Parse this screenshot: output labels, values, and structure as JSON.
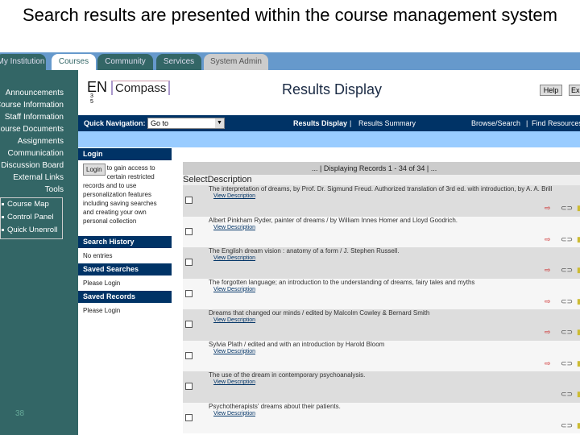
{
  "slide_title": "Search results are presented within the course management system",
  "tabs": [
    {
      "label": "My Institution"
    },
    {
      "label": "Courses"
    },
    {
      "label": "Community"
    },
    {
      "label": "Services"
    },
    {
      "label": "System Admin"
    }
  ],
  "sidebar": {
    "items": [
      "Announcements",
      "Course Information",
      "Staff Information",
      "Course Documents",
      "Assignments",
      "Communication",
      "Discussion Board",
      "External Links",
      "Tools"
    ],
    "tools": [
      "Course Map",
      "Control Panel",
      "Quick Unenroll"
    ]
  },
  "slide_number": "38",
  "logo": {
    "course": "EN",
    "number": "3 5",
    "name": "Compass"
  },
  "page_title": "Results Display",
  "help_label": "Help",
  "exit_label": "Exit",
  "quick_nav": {
    "label": "Quick Navigation:",
    "value": "Go to"
  },
  "nav": {
    "current": "Results Display",
    "summary": "Results Summary",
    "browse": "Browse/Search",
    "find": "Find Resources"
  },
  "panels": {
    "login_head": "Login",
    "login_button": "Login",
    "login_text": "to gain access to certain restricted records and to use personalization features including saving searches and creating your own personal collection",
    "history_head": "Search History",
    "history_text": "No entries",
    "saved_searches_head": "Saved Searches",
    "saved_searches_text": "Please Login",
    "saved_records_head": "Saved Records",
    "saved_records_text": "Please Login"
  },
  "results": {
    "status": "... | Displaying Records 1 - 34 of 34 | ...",
    "col_select": "Select",
    "col_description": "Description",
    "view_label": "View Description",
    "rows": [
      "The interpretation of dreams, by Prof. Dr. Sigmund Freud. Authorized translation of 3rd ed. with introduction, by A. A. Brill",
      "Albert Pinkham Ryder, painter of dreams / by William Innes Homer and Lloyd Goodrich.",
      "The English dream vision : anatomy of a form / J. Stephen Russell.",
      "The forgotten language; an introduction to the understanding of dreams, fairy tales and myths",
      "Dreams that changed our minds / edited by Malcolm Cowley & Bernard Smith",
      "Sylvia Plath / edited and with an introduction by Harold Bloom",
      "The use of the dream in contemporary psychoanalysis.",
      "Psychotherapists' dreams about their patients."
    ]
  }
}
